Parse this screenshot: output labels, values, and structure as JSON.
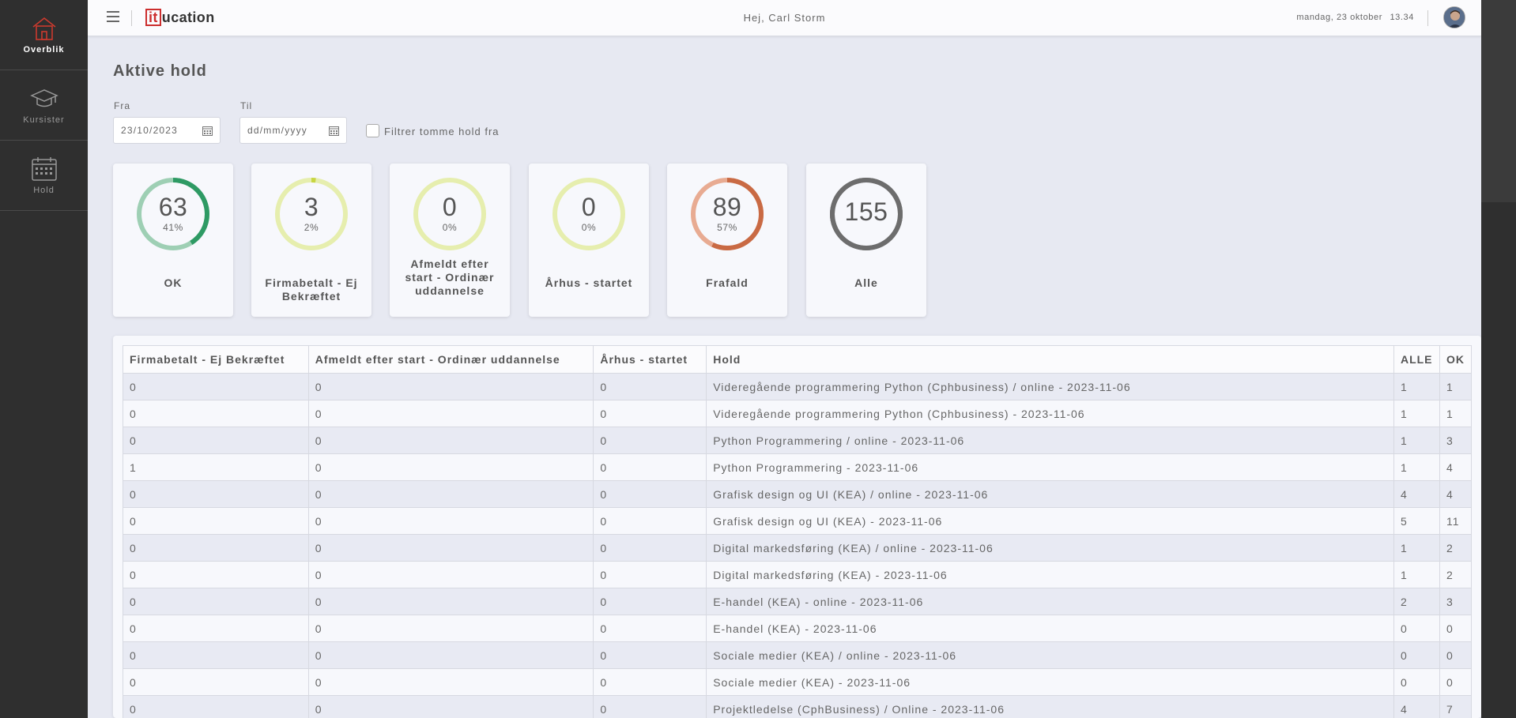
{
  "sidebar": {
    "items": [
      {
        "label": "Overblik",
        "icon": "home-icon",
        "active": true
      },
      {
        "label": "Kursister",
        "icon": "graduation-cap-icon",
        "active": false
      },
      {
        "label": "Hold",
        "icon": "calendar-icon",
        "active": false
      }
    ]
  },
  "header": {
    "logo_box": "it",
    "logo_rest": "ucation",
    "greeting": "Hej, Carl Storm",
    "date": "mandag, 23 oktober",
    "time": "13.34"
  },
  "page": {
    "title": "Aktive hold"
  },
  "filters": {
    "from_label": "Fra",
    "from_value": "23/10/2023",
    "to_label": "Til",
    "to_placeholder": "dd/mm/yyyy",
    "empty_filter_label": "Filtrer tomme hold fra",
    "empty_filter_checked": false
  },
  "cards": [
    {
      "value": "63",
      "percent": "41%",
      "label": "OK",
      "fraction": 0.41,
      "color": "#2e9a64",
      "track": "#9ecfb4"
    },
    {
      "value": "3",
      "percent": "2%",
      "label": "Firmabetalt - Ej Bekræftet",
      "fraction": 0.02,
      "color": "#c8d642",
      "track": "#e6eeae"
    },
    {
      "value": "0",
      "percent": "0%",
      "label": "Afmeldt efter start - Ordinær uddannelse",
      "fraction": 0,
      "color": "#c8d642",
      "track": "#e6eeae"
    },
    {
      "value": "0",
      "percent": "0%",
      "label": "Århus - startet",
      "fraction": 0,
      "color": "#c8d642",
      "track": "#e6eeae"
    },
    {
      "value": "89",
      "percent": "57%",
      "label": "Frafald",
      "fraction": 0.57,
      "color": "#c96a44",
      "track": "#e8ab92"
    },
    {
      "value": "155",
      "percent": "",
      "label": "Alle",
      "fraction": 1,
      "color": "#6d6d6d",
      "track": "#6d6d6d"
    }
  ],
  "table": {
    "headers": [
      "Firmabetalt - Ej Bekræftet",
      "Afmeldt efter start - Ordinær uddannelse",
      "Århus - startet",
      "Hold",
      "ALLE",
      "OK"
    ],
    "rows": [
      [
        "0",
        "0",
        "0",
        "Videregående programmering Python (Cphbusiness) / online - 2023-11-06",
        "1",
        "1"
      ],
      [
        "0",
        "0",
        "0",
        "Videregående programmering Python (Cphbusiness) - 2023-11-06",
        "1",
        "1"
      ],
      [
        "0",
        "0",
        "0",
        "Python Programmering / online - 2023-11-06",
        "1",
        "3"
      ],
      [
        "1",
        "0",
        "0",
        "Python Programmering - 2023-11-06",
        "1",
        "4"
      ],
      [
        "0",
        "0",
        "0",
        "Grafisk design og UI (KEA) / online - 2023-11-06",
        "4",
        "4"
      ],
      [
        "0",
        "0",
        "0",
        "Grafisk design og UI (KEA) - 2023-11-06",
        "5",
        "11"
      ],
      [
        "0",
        "0",
        "0",
        "Digital markedsføring (KEA) / online - 2023-11-06",
        "1",
        "2"
      ],
      [
        "0",
        "0",
        "0",
        "Digital markedsføring (KEA) - 2023-11-06",
        "1",
        "2"
      ],
      [
        "0",
        "0",
        "0",
        "E-handel (KEA) - online - 2023-11-06",
        "2",
        "3"
      ],
      [
        "0",
        "0",
        "0",
        "E-handel (KEA) - 2023-11-06",
        "0",
        "0"
      ],
      [
        "0",
        "0",
        "0",
        "Sociale medier (KEA) / online - 2023-11-06",
        "0",
        "0"
      ],
      [
        "0",
        "0",
        "0",
        "Sociale medier (KEA) - 2023-11-06",
        "0",
        "0"
      ],
      [
        "0",
        "0",
        "0",
        "Projektledelse (CphBusiness) / Online - 2023-11-06",
        "4",
        "7"
      ]
    ]
  }
}
